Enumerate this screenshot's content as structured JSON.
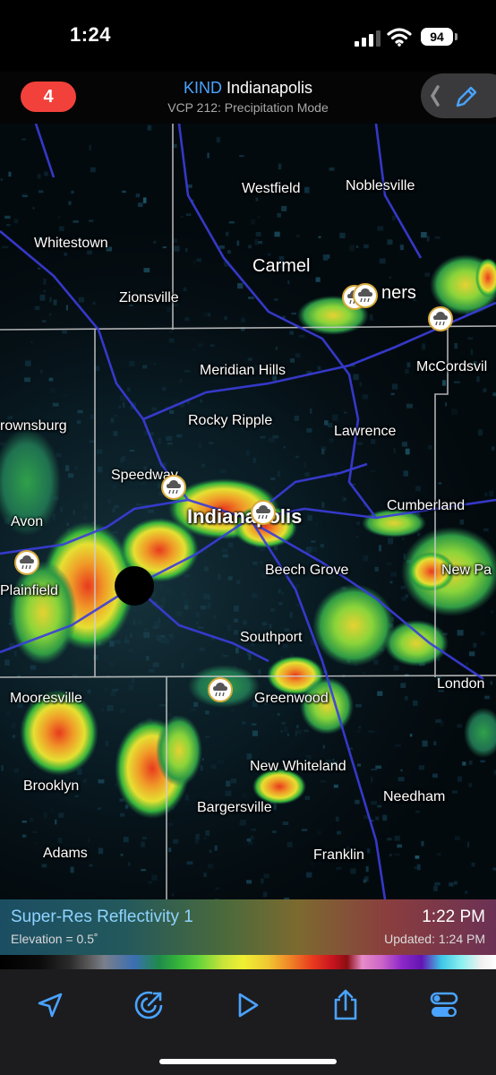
{
  "status_bar": {
    "time": "1:24",
    "battery": "94"
  },
  "header": {
    "alert_count": "4",
    "station_id": "KIND",
    "station_name": "Indianapolis",
    "subtitle": "VCP 212: Precipitation Mode"
  },
  "map": {
    "cities": [
      {
        "name": "Westfield"
      },
      {
        "name": "Noblesville"
      },
      {
        "name": "Whitestown"
      },
      {
        "name": "Carmel"
      },
      {
        "name": "Zionsville"
      },
      {
        "name": "ners"
      },
      {
        "name": "Meridian Hills"
      },
      {
        "name": "McCordsvil"
      },
      {
        "name": "rownsburg"
      },
      {
        "name": "Rocky Ripple"
      },
      {
        "name": "Lawrence"
      },
      {
        "name": "Speedway"
      },
      {
        "name": "Indianapolis"
      },
      {
        "name": "Cumberland"
      },
      {
        "name": "Avon"
      },
      {
        "name": "Beech Grove"
      },
      {
        "name": "New Pa"
      },
      {
        "name": "Plainfield"
      },
      {
        "name": "Southport"
      },
      {
        "name": "London"
      },
      {
        "name": "Mooresville"
      },
      {
        "name": "Greenwood"
      },
      {
        "name": "New Whiteland"
      },
      {
        "name": "Brooklyn"
      },
      {
        "name": "Bargersville"
      },
      {
        "name": "Needham"
      },
      {
        "name": "Adams"
      },
      {
        "name": "Franklin"
      }
    ]
  },
  "legend": {
    "product": "Super-Res Reflectivity 1",
    "elevation": "Elevation = 0.5˚",
    "scan_time": "1:22 PM",
    "updated": "Updated: 1:24 PM"
  },
  "toolbar": {
    "icons": [
      "location-arrow-icon",
      "radar-sweep-icon",
      "play-icon",
      "share-icon",
      "layers-toggle-icon"
    ]
  },
  "colors": {
    "accent": "#4aa3ff",
    "alert": "#f2413b",
    "roads": "#3a3ad8"
  }
}
